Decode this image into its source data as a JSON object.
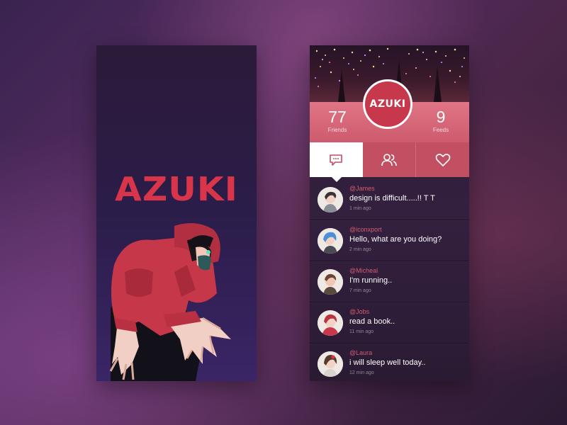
{
  "splash": {
    "logo_text": "AZUKI"
  },
  "profile": {
    "badge_text": "AZUKI",
    "stats": {
      "friends_value": "77",
      "friends_label": "Friends",
      "feeds_value": "9",
      "feeds_label": "Feeds"
    },
    "tabs": [
      {
        "icon": "chat-bubble-icon",
        "active": true
      },
      {
        "icon": "friends-icon",
        "active": false
      },
      {
        "icon": "heart-icon",
        "active": false
      }
    ],
    "feed": [
      {
        "handle": "@James",
        "message": "design is difficult.....!! T T",
        "time": "1 min ago",
        "avatar": "james-avatar"
      },
      {
        "handle": "@iconxport",
        "message": "Hello, what are you doing?",
        "time": "2 min ago",
        "avatar": "iconxport-avatar"
      },
      {
        "handle": "@Micheal",
        "message": "I'm running..",
        "time": "7 min ago",
        "avatar": "micheal-avatar"
      },
      {
        "handle": "@Jobs",
        "message": "read a book..",
        "time": "11 min ago",
        "avatar": "jobs-avatar"
      },
      {
        "handle": "@Laura",
        "message": "i will sleep well today..",
        "time": "12 min ago",
        "avatar": "laura-avatar"
      }
    ]
  },
  "colors": {
    "accent": "#d8354a",
    "stats_bar": "#d9697a",
    "tab_bar": "#c24f62",
    "handle": "#d35c6e"
  }
}
